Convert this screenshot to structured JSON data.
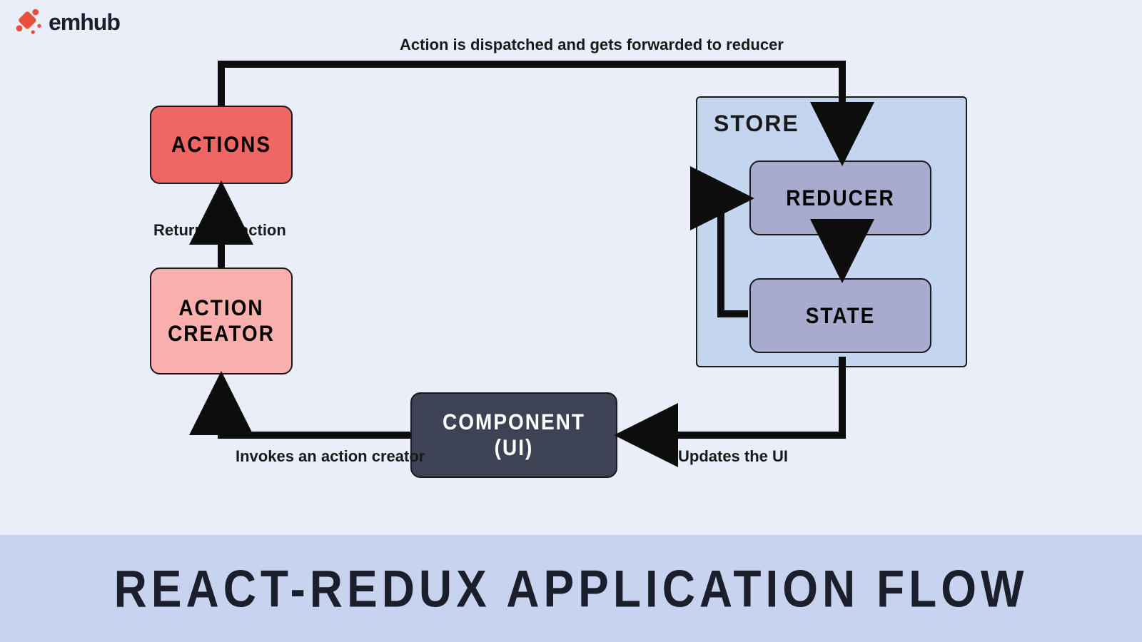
{
  "brand": {
    "name": "emhub"
  },
  "title": "REACT-REDUX  APPLICATION  FLOW",
  "nodes": {
    "actions": "ACTIONS",
    "actionCreator": "ACTION\nCREATOR",
    "component": "COMPONENT\n(UI)",
    "store": "STORE",
    "reducer": "REDUCER",
    "state": "STATE"
  },
  "edges": {
    "dispatch": "Action is dispatched and gets forwarded to reducer",
    "returnsAction": "Returns an action",
    "invokesCreator": "Invokes an action creator",
    "updatesUI": "Updates the UI"
  },
  "colors": {
    "bg": "#eaeef9",
    "band": "#c8d4ef",
    "actions": "#ee6764",
    "creator": "#f9b0ac",
    "component": "#3d4255",
    "store": "#c4d5f0",
    "storeNode": "#a7abce",
    "stroke": "#0d0d0d",
    "accent": "#e94f3d"
  }
}
